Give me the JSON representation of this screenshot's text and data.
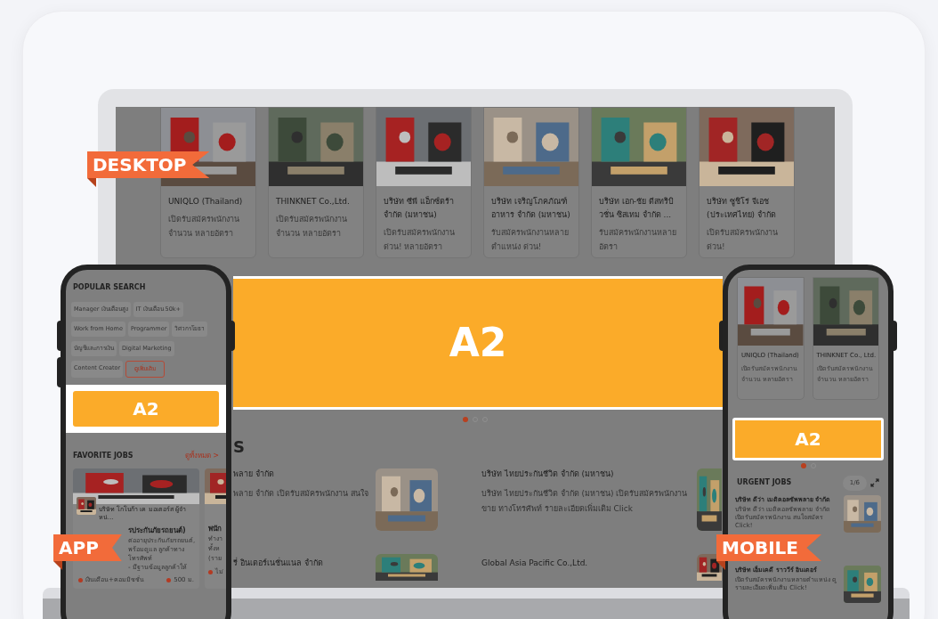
{
  "desktop": {
    "label": "DESKTOP",
    "company_cards": [
      {
        "name": "UNIQLO (Thailand)",
        "description": "เปิดรับสมัครพนักงาน จำนวน หลายอัตรา"
      },
      {
        "name": "THINKNET Co.,Ltd.",
        "description": "เปิดรับสมัครพนักงาน จำนวน หลายอัตรา"
      },
      {
        "name": "บริษัท ซีพี แอ็กซ์ตร้า จำกัด (มหาชน)",
        "description": "เปิดรับสมัครพนักงาน ด่วน! หลายอัตรา"
      },
      {
        "name": "บริษัท เจริญโภคภัณฑ์อาหาร จำกัด (มหาชน)",
        "description": "รับสมัครพนักงานหลายตำแหน่ง ด่วน!"
      },
      {
        "name": "บริษัท เอก-ชัย ดีสทริบิวชั่น ซิสเทม จำกัด ...",
        "description": "รับสมัครพนักงานหลายอัตรา"
      },
      {
        "name": "บริษัท ซูชิโร่ จีเอช (ประเทศไทย) จำกัด",
        "description": "เปิดรับสมัครพนักงาน ด่วน!"
      }
    ],
    "banner": "A2",
    "carousel": [
      {
        "selected": true
      },
      {
        "selected": false
      },
      {
        "selected": false
      }
    ],
    "section_title": "S",
    "jobs": [
      {
        "title": "พลาย จำกัด",
        "description": "พลาย จำกัด เปิดรับสมัครพนักงาน สนใจ"
      },
      {
        "title": "บริษัท ไทยประกันชีวิต จำกัด (มหาชน)",
        "description": "บริษัท ไทยประกันชีวิต จำกัด (มหาชน) เปิดรับสมัครพนักงานขาย ทางโทรศัพท์ รายละเอียดเพิ่มเติม Click"
      },
      {
        "title": "รี่ อินเตอร์เนชั่นแนล จำกัด"
      },
      {
        "title": "Global Asia Pacific Co.,Ltd."
      }
    ]
  },
  "app": {
    "label": "APP",
    "popular_title": "POPULAR SEARCH",
    "chips": [
      {
        "text": "Manager เงินเดือนสูง",
        "kind": "tag"
      },
      {
        "text": "IT เงินเดือน 50k+",
        "kind": "tag"
      },
      {
        "text": "Work from Home",
        "kind": "tag"
      },
      {
        "text": "Programmer",
        "kind": "tag"
      },
      {
        "text": "วิศวกรโยธา",
        "kind": "tag"
      },
      {
        "text": "บัญชีและการเงิน",
        "kind": "tag"
      },
      {
        "text": "Digital Marketing",
        "kind": "tag"
      },
      {
        "text": "Content Creator",
        "kind": "tag"
      },
      {
        "text": "ดูเพิ่มเติม",
        "kind": "more"
      }
    ],
    "banner": "A2",
    "favorite_title": "FAVORITE JOBS",
    "see_all": "ดูทั้งหมด >",
    "job_card": {
      "company": "บริษัท โกโบก้า เค มอเตอร์ส ผู้จำหน่...",
      "title": "รประกันภัยรถยนต์)",
      "description": [
        "ต่ออายุประกันภัยรถยนต์,",
        "พร้อมดูแล ลูกค้าทางโทรศัพท์",
        "- มีฐานข้อมูลลูกค้าให้"
      ],
      "salary": "เงินเดือน+คอมมิชชั่น",
      "distance": "500 ม."
    },
    "next_card": {
      "title": "พนัก",
      "description": [
        "ทำงา",
        "ทั้งห",
        "(ราย"
      ],
      "salary": "ไม่"
    }
  },
  "mobile": {
    "label": "MOBILE",
    "company_cards": [
      {
        "name": "UNIQLO (Thailand)",
        "description": "เปิดรับสมัครพนักงาน จำนวน หลายอัตรา"
      },
      {
        "name": "THINKNET Co., Ltd.",
        "description": "เปิดรับสมัครพนักงาน จำนวน หลายอัตรา"
      }
    ],
    "banner": "A2",
    "carousel": [
      {
        "selected": true
      },
      {
        "selected": false
      }
    ],
    "urgent_title": "URGENT JOBS",
    "pager": "1/6",
    "jobs": [
      {
        "title": "บริษัท ดีว่า เมดิคอลซัพพลาย จำกัด",
        "description": "บริษัท ดีว่า เมดิคอลซัพพลาย จำกัด เปิดรับสมัครพนักงาน สนใจสมัคร Click!"
      },
      {
        "title": "บริษัท เอ็มเคดี ราววีร์ อินเตอร์",
        "description": "เปิดรับสมัครพนักงานหลายตำแหน่ง ดูรายละเอียดเพิ่มเติม Click!"
      }
    ]
  }
}
